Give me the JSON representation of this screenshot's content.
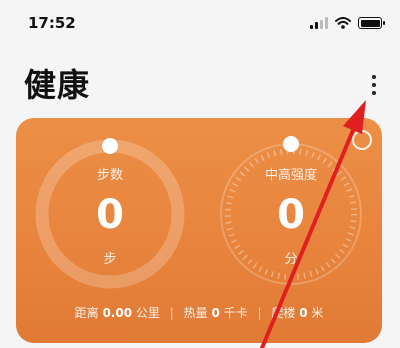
{
  "status_bar": {
    "time": "17:52"
  },
  "header": {
    "title": "健康"
  },
  "card": {
    "steps": {
      "label": "步数",
      "value": "0",
      "unit": "步"
    },
    "intensity": {
      "label": "中高强度",
      "value": "0",
      "unit": "分"
    },
    "summary": {
      "distance_label": "距离",
      "distance_value": "0.00",
      "distance_unit": "公里",
      "calorie_label": "热量",
      "calorie_value": "0",
      "calorie_unit": "千卡",
      "floors_label": "爬楼",
      "floors_value": "0",
      "floors_unit": "米"
    }
  },
  "colors": {
    "card": "#ea8741",
    "arrow": "#e02020"
  },
  "icons": {
    "menu": "more-vertical-icon"
  }
}
